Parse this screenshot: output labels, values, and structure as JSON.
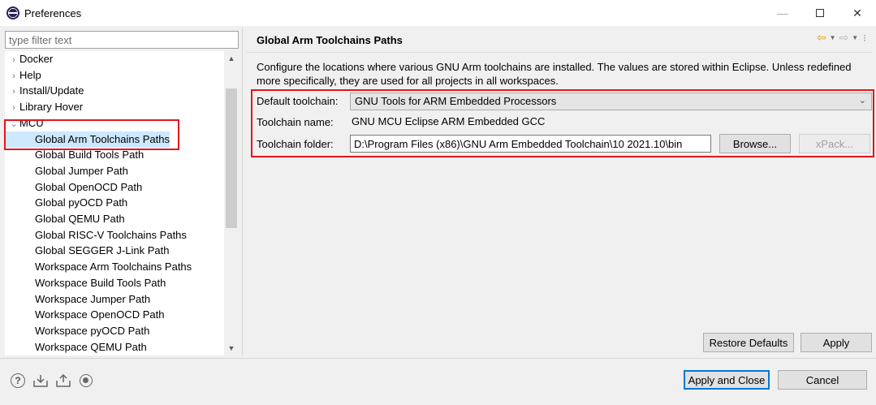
{
  "window": {
    "title": "Preferences",
    "minimize": "—",
    "close": "✕"
  },
  "filter": {
    "placeholder": "type filter text"
  },
  "tree": {
    "expander_collapsed": "›",
    "expander_expanded": "⌄",
    "scroll_up": "▲",
    "scroll_down": "▼",
    "top_items": [
      "Docker",
      "Help",
      "Install/Update",
      "Library Hover",
      "MCU"
    ],
    "mcu_children": [
      "Global Arm Toolchains Paths",
      "Global Build Tools Path",
      "Global Jumper Path",
      "Global OpenOCD Path",
      "Global pyOCD Path",
      "Global QEMU Path",
      "Global RISC-V Toolchains Paths",
      "Global SEGGER J-Link Path",
      "Workspace Arm Toolchains Paths",
      "Workspace Build Tools Path",
      "Workspace Jumper Path",
      "Workspace OpenOCD Path",
      "Workspace pyOCD Path",
      "Workspace QEMU Path"
    ],
    "selected": "Global Arm Toolchains Paths"
  },
  "page": {
    "title": "Global Arm Toolchains Paths",
    "nav": {
      "back": "⇦",
      "forward": "⇨",
      "dropdown": "▼",
      "menu": "⁝"
    },
    "description": "Configure the locations where various GNU Arm toolchains are installed. The values are stored within Eclipse. Unless redefined more specifically, they are used for all projects in all workspaces.",
    "default_toolchain_label": "Default toolchain:",
    "default_toolchain_value": "GNU Tools for ARM Embedded Processors",
    "toolchain_name_label": "Toolchain name:",
    "toolchain_name_value": "GNU MCU Eclipse ARM Embedded GCC",
    "toolchain_folder_label": "Toolchain folder:",
    "toolchain_folder_value": "D:\\Program Files (x86)\\GNU Arm Embedded Toolchain\\10 2021.10\\bin",
    "browse_label": "Browse...",
    "xpack_label": "xPack...",
    "restore_defaults_label": "Restore Defaults",
    "apply_label": "Apply"
  },
  "footer": {
    "apply_close_label": "Apply and Close",
    "cancel_label": "Cancel",
    "icons": [
      "help-icon",
      "import-icon",
      "export-icon",
      "record-icon"
    ]
  },
  "colors": {
    "highlight_border": "#e4161b",
    "selection": "#cde8ff",
    "default_button_border": "#0078d7"
  }
}
